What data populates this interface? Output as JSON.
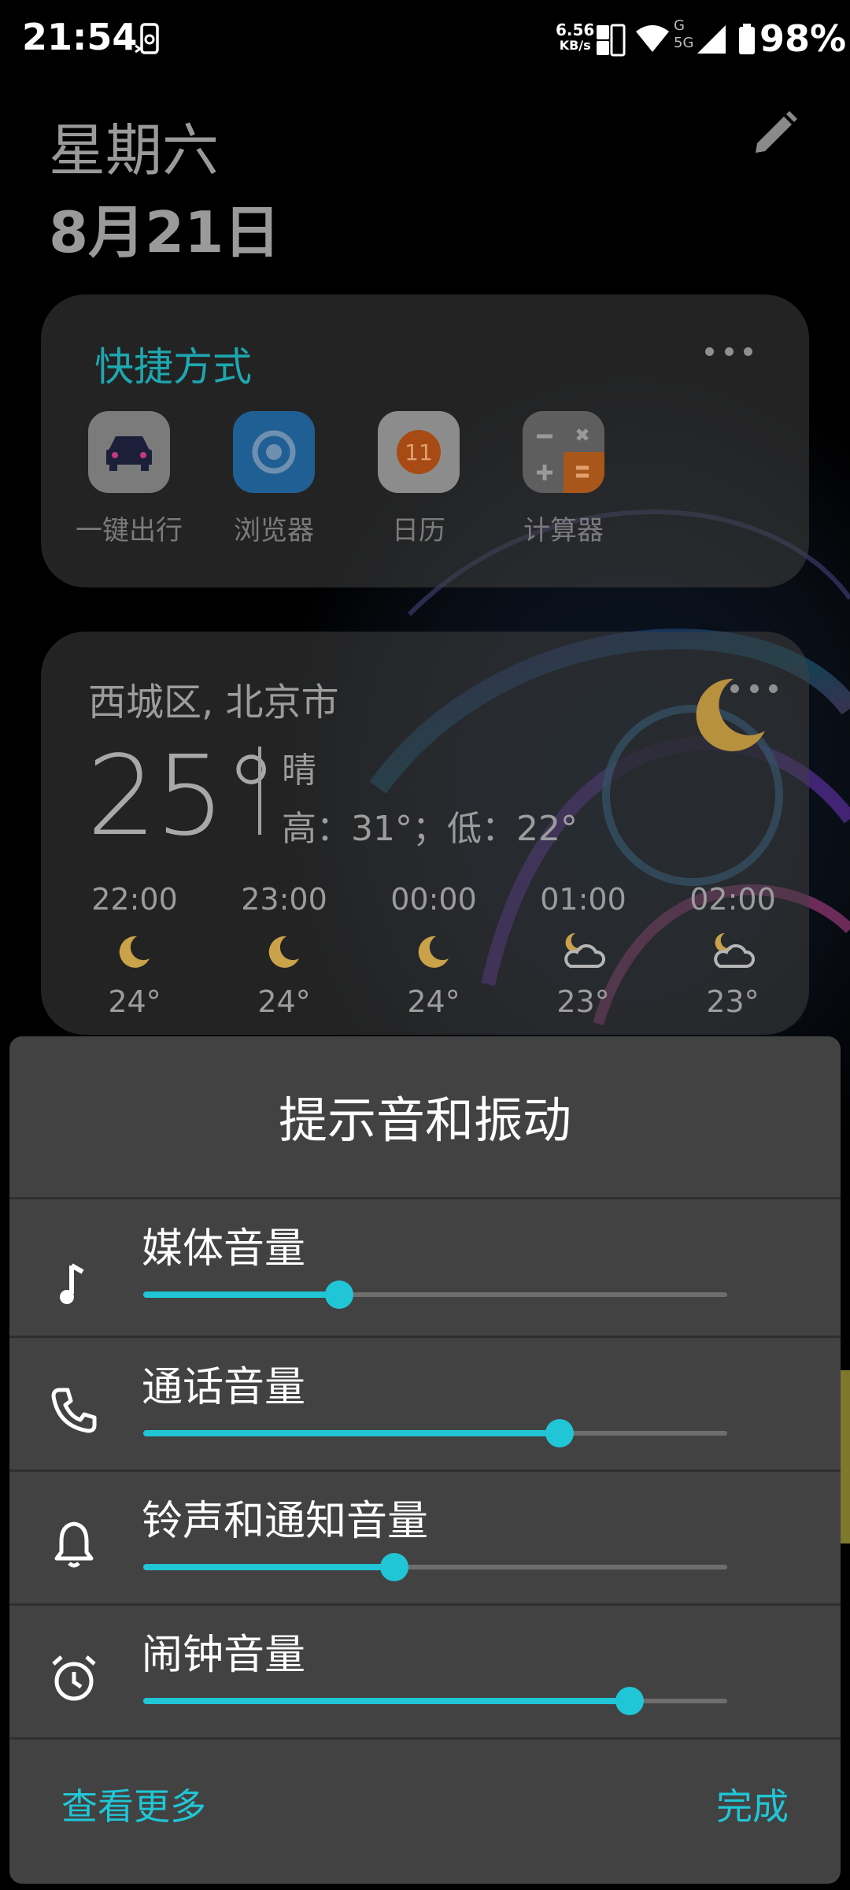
{
  "status_bar": {
    "time": "21:54",
    "net_speed_value": "6.56",
    "net_speed_unit": "KB/s",
    "battery": "98%",
    "network_labels": [
      "G",
      "5G"
    ]
  },
  "header": {
    "weekday": "星期六",
    "date": "8月21日"
  },
  "shortcuts": {
    "title": "快捷方式",
    "items": [
      {
        "label": "一键出行",
        "icon": "car-icon"
      },
      {
        "label": "浏览器",
        "icon": "browser-icon"
      },
      {
        "label": "日历",
        "icon": "calendar-icon",
        "badge": "11"
      },
      {
        "label": "计算器",
        "icon": "calculator-icon"
      }
    ]
  },
  "weather": {
    "location": "西城区, 北京市",
    "temperature": "25°",
    "condition": "晴",
    "hi_lo": "高：31°；低：22°",
    "hourly": [
      {
        "time": "22:00",
        "icon": "moon-icon",
        "temp": "24°"
      },
      {
        "time": "23:00",
        "icon": "moon-icon",
        "temp": "24°"
      },
      {
        "time": "00:00",
        "icon": "moon-icon",
        "temp": "24°"
      },
      {
        "time": "01:00",
        "icon": "moon-cloud-icon",
        "temp": "23°"
      },
      {
        "time": "02:00",
        "icon": "moon-cloud-icon",
        "temp": "23°"
      }
    ]
  },
  "volume_panel": {
    "title": "提示音和振动",
    "rows": [
      {
        "label": "媒体音量",
        "icon": "music-note-icon",
        "level": 0.335
      },
      {
        "label": "通话音量",
        "icon": "phone-icon",
        "level": 0.713
      },
      {
        "label": "铃声和通知音量",
        "icon": "bell-icon",
        "level": 0.43
      },
      {
        "label": "闹钟音量",
        "icon": "alarm-icon",
        "level": 0.833
      }
    ],
    "more_label": "查看更多",
    "done_label": "完成"
  },
  "colors": {
    "accent": "#20c6d6",
    "shortcut_title": "#1ea7b0",
    "panel_bg": "#424242",
    "moon": "#c9a24a"
  }
}
